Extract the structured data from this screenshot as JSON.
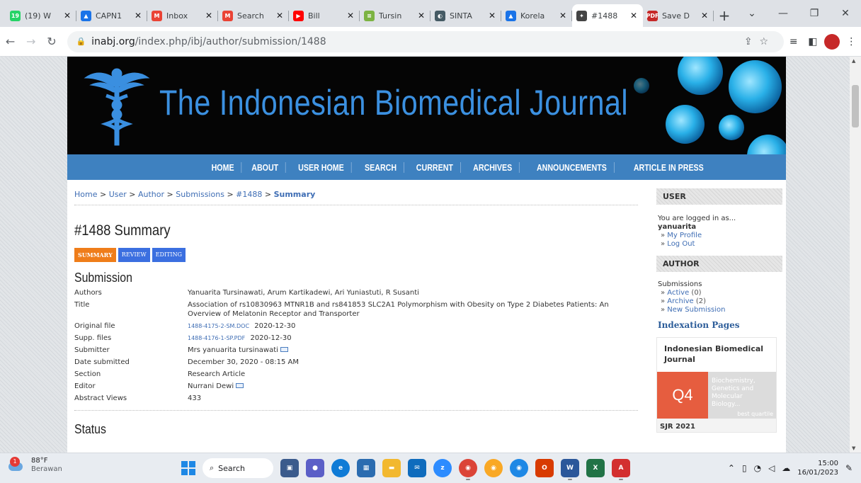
{
  "browser": {
    "tabs": [
      {
        "label": "(19) W",
        "favicon_color": "#25d366",
        "favicon_text": "19"
      },
      {
        "label": "CAPN1",
        "favicon_color": "#1a73e8",
        "favicon_text": "▲"
      },
      {
        "label": "Inbox",
        "favicon_color": "#ea4335",
        "favicon_text": "M"
      },
      {
        "label": "Search",
        "favicon_color": "#ea4335",
        "favicon_text": "M"
      },
      {
        "label": "Bill",
        "favicon_color": "#ff0000",
        "favicon_text": "▶"
      },
      {
        "label": "Tursin",
        "favicon_color": "#7cb342",
        "favicon_text": "≡"
      },
      {
        "label": "SINTA",
        "favicon_color": "#455a64",
        "favicon_text": "◐"
      },
      {
        "label": "Korela",
        "favicon_color": "#1a73e8",
        "favicon_text": "▲"
      },
      {
        "label": "#1488",
        "favicon_color": "#444444",
        "favicon_text": "✦",
        "active": true
      },
      {
        "label": "Save D",
        "favicon_color": "#c62828",
        "favicon_text": "PDF"
      }
    ],
    "new_tab": "+",
    "url_host": "inabj.org",
    "url_path": "/index.php/ibj/author/submission/1488"
  },
  "site": {
    "title": "The Indonesian Biomedical Journal",
    "nav": [
      "HOME",
      "ABOUT",
      "USER HOME",
      "SEARCH",
      "CURRENT",
      "ARCHIVES",
      "ANNOUNCEMENTS",
      "ARTICLE IN PRESS"
    ]
  },
  "breadcrumb": {
    "items": [
      "Home",
      "User",
      "Author",
      "Submissions",
      "#1488"
    ],
    "current": "Summary",
    "separator": ">"
  },
  "page_title": "#1488 Summary",
  "subtabs": [
    "SUMMARY",
    "REVIEW",
    "EDITING"
  ],
  "submission": {
    "heading": "Submission",
    "labels": {
      "authors": "Authors",
      "title": "Title",
      "original_file": "Original file",
      "supp_files": "Supp. files",
      "submitter": "Submitter",
      "date_submitted": "Date submitted",
      "section": "Section",
      "editor": "Editor",
      "abstract_views": "Abstract Views"
    },
    "authors": "Yanuarita Tursinawati, Arum Kartikadewi, Ari Yuniastuti, R Susanti",
    "title_line1": "Association of rs10830963 MTNR1B and rs841853 SLC2A1 Polymorphism with Obesity on Type 2 Diabetes Patients: An",
    "title_line2": "Overview of Melatonin Receptor and Transporter",
    "original_file_name": "1488-4175-2-SM.DOC",
    "original_file_date": "2020-12-30",
    "supp_file_name": "1488-4176-1-SP.PDF",
    "supp_file_date": "2020-12-30",
    "submitter": "Mrs yanuarita tursinawati",
    "date_submitted": "December 30, 2020 - 08:15 AM",
    "section": "Research Article",
    "editor": "Nurrani Dewi",
    "abstract_views": "433"
  },
  "status_heading": "Status",
  "sidebar": {
    "user_heading": "USER",
    "logged_in_as": "You are logged in as...",
    "username": "yanuarita",
    "my_profile": "My Profile",
    "log_out": "Log Out",
    "author_heading": "AUTHOR",
    "submissions_label": "Submissions",
    "active": "Active",
    "active_count": "(0)",
    "archive": "Archive",
    "archive_count": "(2)",
    "new_submission": "New Submission",
    "indexation": "Indexation Pages",
    "ibj_name": "Indonesian Biomedical Journal",
    "quartile": "Q4",
    "category": "Biochemistry, Genetics and Molecular Biology...",
    "best_quartile": "best quartile",
    "sjr": "SJR 2021"
  },
  "taskbar": {
    "temperature": "88°F",
    "weather": "Berawan",
    "weather_badge": "1",
    "search_label": "Search",
    "time": "15:00",
    "date": "16/01/2023"
  }
}
